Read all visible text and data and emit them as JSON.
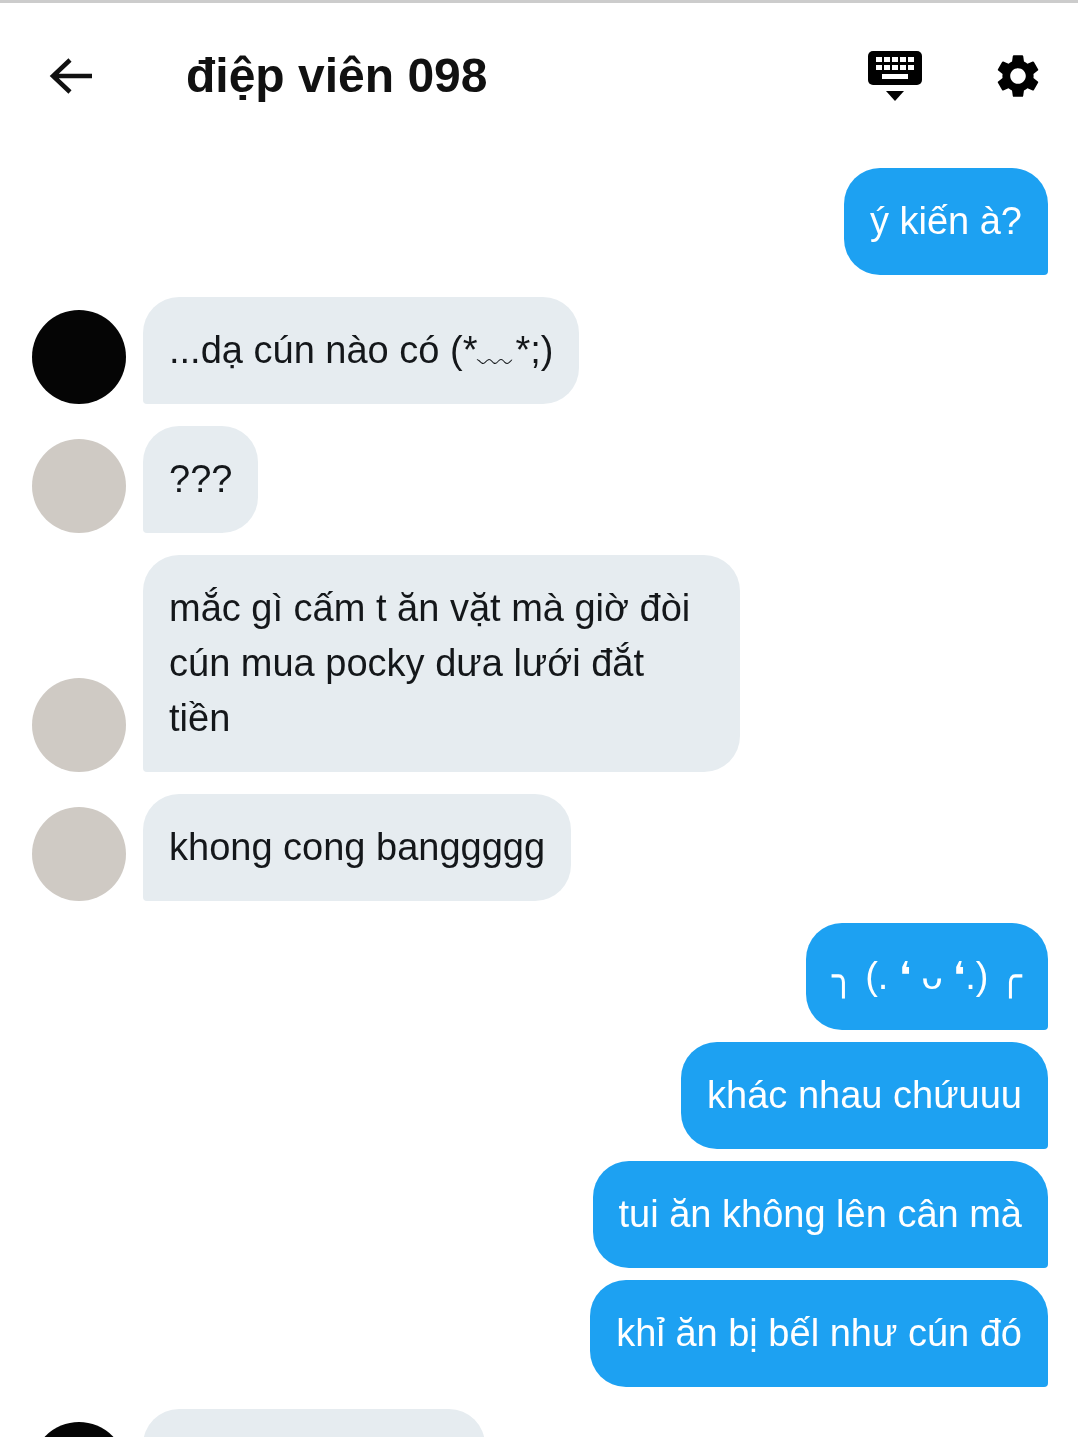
{
  "header": {
    "title": "điệp viên 098"
  },
  "messages": [
    {
      "kind": "sent",
      "text": "ý kiến à?"
    },
    {
      "kind": "received",
      "avatar": {
        "color": "#050505"
      },
      "text": "...dạ cún nào có (*﹏*;)"
    },
    {
      "kind": "received",
      "avatar": {
        "color": "#cfcac4"
      },
      "text": "???"
    },
    {
      "kind": "received",
      "avatar": {
        "color": "#cfcac4"
      },
      "text": "mắc gì cấm t ăn vặt mà giờ đòi cún mua pocky dưa lưới đắt tiền"
    },
    {
      "kind": "received",
      "avatar": {
        "color": "#cfcac4"
      },
      "text": "khong cong banggggg"
    },
    {
      "kind": "sent",
      "text": "╮ (. ❛ ᴗ ❛.) ╭"
    },
    {
      "kind": "sent",
      "text": "khác nhau chứuuu"
    },
    {
      "kind": "sent",
      "text": "tui ăn không lên cân mà"
    },
    {
      "kind": "sent",
      "text": "khỉ ăn bị bếl như cún đó"
    },
    {
      "kind": "received",
      "avatar": {
        "color": "#050505"
      }
    }
  ]
}
